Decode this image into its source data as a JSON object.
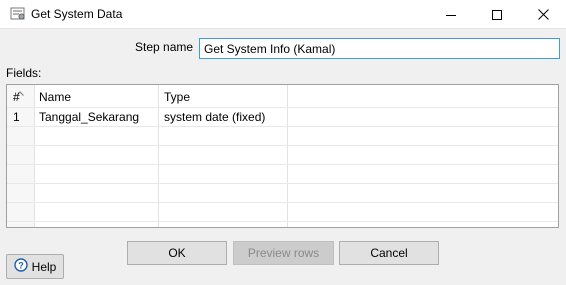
{
  "window": {
    "title": "Get System Data",
    "icon": "gear-step-icon",
    "controls": [
      "minimize-icon",
      "maximize-icon",
      "close-icon"
    ]
  },
  "form": {
    "step_name_label": "Step name",
    "step_name_value": "Get System Info (Kamal)",
    "fields_label": "Fields:"
  },
  "table": {
    "columns": [
      "#",
      "Name",
      "Type"
    ],
    "rows": [
      {
        "num": "1",
        "name": "Tanggal_Sekarang",
        "type": "system date (fixed)"
      }
    ]
  },
  "buttons": {
    "ok": "OK",
    "preview": "Preview rows",
    "cancel": "Cancel",
    "help": "Help"
  },
  "colors": {
    "window_bg": "#f0f0f0",
    "input_focus_border": "#3c9de0",
    "help_icon": "#1f5fa8"
  }
}
